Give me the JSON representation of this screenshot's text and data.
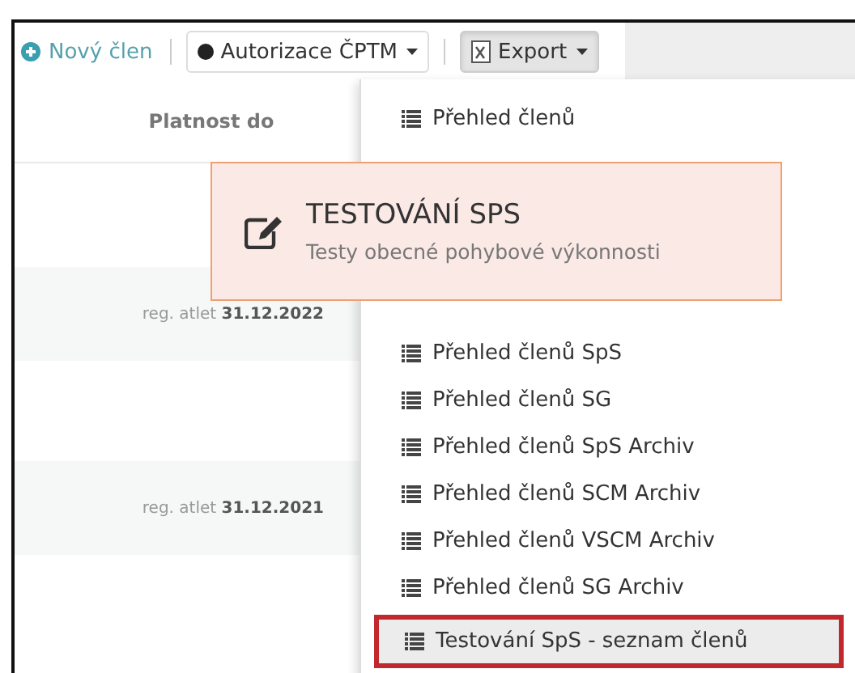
{
  "toolbar": {
    "new_member": "Nový člen",
    "authorization": {
      "label": "Autorizace ČPTM"
    },
    "export": {
      "label": "Export",
      "pressed": true
    }
  },
  "table": {
    "columns": [
      "Platnost do"
    ],
    "rows": [
      {
        "validity": "reg. atlet **31.12.2022**"
      },
      {
        "validity": "reg. atlet **31.12.2021**"
      }
    ]
  },
  "export_menu": {
    "items": [
      {
        "label": "Přehled členů",
        "highlighted": false
      },
      {
        "label": "Přehled členů SpS",
        "highlighted": false
      },
      {
        "label": "Přehled členů SG",
        "highlighted": false
      },
      {
        "label": "Přehled členů SpS Archiv",
        "highlighted": false
      },
      {
        "label": "Přehled členů SCM Archiv",
        "highlighted": false
      },
      {
        "label": "Přehled členů VSCM Archiv",
        "highlighted": false
      },
      {
        "label": "Přehled členů SG Archiv",
        "highlighted": false
      },
      {
        "label": "Testování SpS - seznam členů",
        "highlighted": true
      }
    ]
  },
  "callout": {
    "title": "TESTOVÁNÍ SPS",
    "subtitle": "Testy obecné pohybové výkonnosti"
  }
}
